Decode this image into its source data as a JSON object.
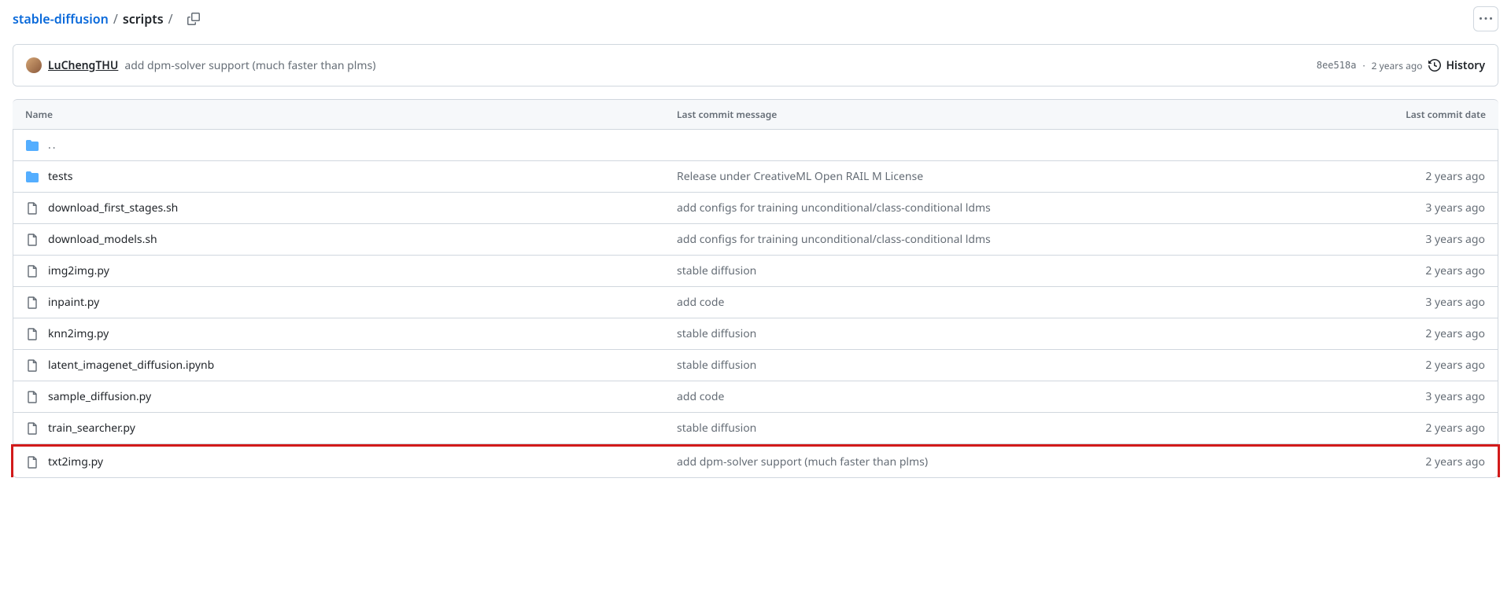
{
  "breadcrumb": {
    "repo": "stable-diffusion",
    "path": "scripts",
    "sep": "/"
  },
  "commit_header": {
    "author": "LuChengTHU",
    "message": "add dpm-solver support (much faster than plms)",
    "hash": "8ee518a",
    "date": "2 years ago",
    "history_label": "History"
  },
  "table_headers": {
    "name": "Name",
    "message": "Last commit message",
    "date": "Last commit date"
  },
  "parent_dir": "..",
  "files": [
    {
      "type": "folder",
      "name": "tests",
      "message": "Release under CreativeML Open RAIL M License",
      "date": "2 years ago",
      "highlighted": false
    },
    {
      "type": "file",
      "name": "download_first_stages.sh",
      "message": "add configs for training unconditional/class-conditional ldms",
      "date": "3 years ago",
      "highlighted": false
    },
    {
      "type": "file",
      "name": "download_models.sh",
      "message": "add configs for training unconditional/class-conditional ldms",
      "date": "3 years ago",
      "highlighted": false
    },
    {
      "type": "file",
      "name": "img2img.py",
      "message": "stable diffusion",
      "date": "2 years ago",
      "highlighted": false
    },
    {
      "type": "file",
      "name": "inpaint.py",
      "message": "add code",
      "date": "3 years ago",
      "highlighted": false
    },
    {
      "type": "file",
      "name": "knn2img.py",
      "message": "stable diffusion",
      "date": "2 years ago",
      "highlighted": false
    },
    {
      "type": "file",
      "name": "latent_imagenet_diffusion.ipynb",
      "message": "stable diffusion",
      "date": "2 years ago",
      "highlighted": false
    },
    {
      "type": "file",
      "name": "sample_diffusion.py",
      "message": "add code",
      "date": "3 years ago",
      "highlighted": false
    },
    {
      "type": "file",
      "name": "train_searcher.py",
      "message": "stable diffusion",
      "date": "2 years ago",
      "highlighted": false
    },
    {
      "type": "file",
      "name": "txt2img.py",
      "message": "add dpm-solver support (much faster than plms)",
      "date": "2 years ago",
      "highlighted": true
    }
  ]
}
